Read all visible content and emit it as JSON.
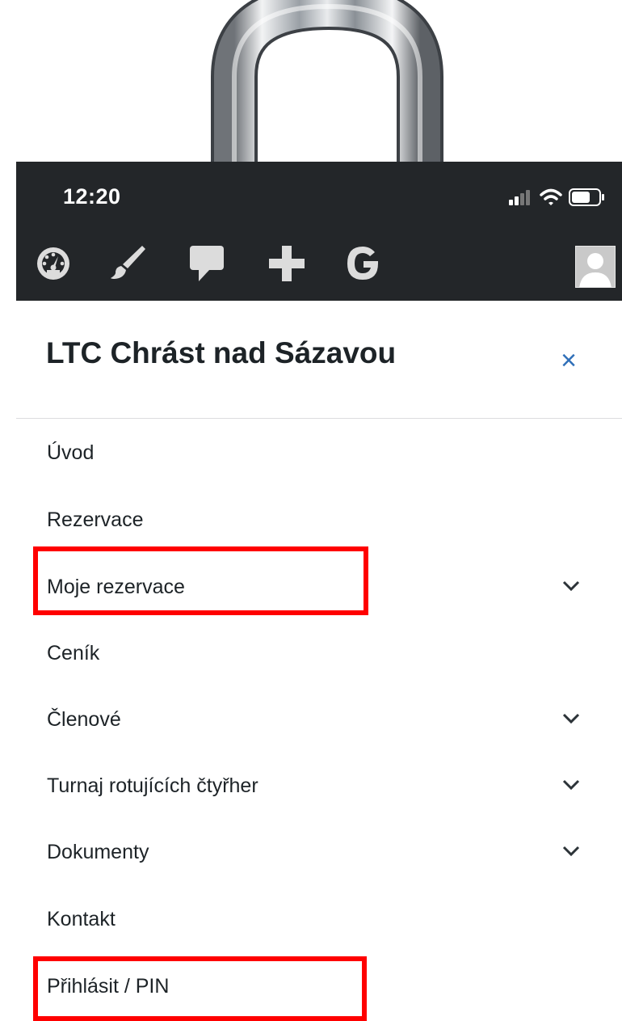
{
  "status_bar": {
    "time": "12:20",
    "icons": [
      "signal-icon",
      "wifi-icon",
      "battery-icon"
    ]
  },
  "toolbar": {
    "icons": [
      "dashboard-icon",
      "brush-icon",
      "comment-icon",
      "plus-icon",
      "google-icon"
    ],
    "avatar": "user-avatar-icon"
  },
  "menu": {
    "title": "LTC Chrást nad Sázavou",
    "close_glyph": "×",
    "items": [
      {
        "label": "Úvod",
        "has_submenu": false
      },
      {
        "label": "Rezervace",
        "has_submenu": false
      },
      {
        "label": "Moje rezervace",
        "has_submenu": true
      },
      {
        "label": "Ceník",
        "has_submenu": false
      },
      {
        "label": "Členové",
        "has_submenu": true
      },
      {
        "label": "Turnaj rotujících čtyřher",
        "has_submenu": true
      },
      {
        "label": "Dokumenty",
        "has_submenu": true
      },
      {
        "label": "Kontakt",
        "has_submenu": false
      },
      {
        "label": "Přihlásit / PIN",
        "has_submenu": false
      }
    ]
  },
  "colors": {
    "toolbar_bg": "#232629",
    "close_icon": "#2f6fb8",
    "highlight": "#ff0000",
    "text": "#1d2327"
  }
}
